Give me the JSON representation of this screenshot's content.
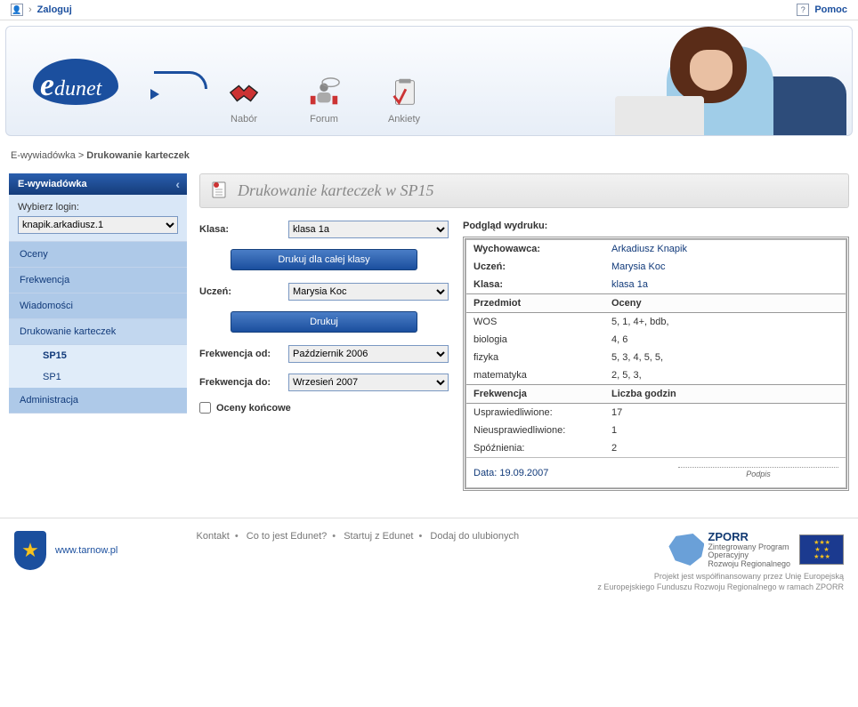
{
  "topbar": {
    "login": "Zaloguj",
    "help": "Pomoc"
  },
  "nav": {
    "items": [
      {
        "label": "Nabór"
      },
      {
        "label": "Forum"
      },
      {
        "label": "Ankiety"
      }
    ]
  },
  "breadcrumb": {
    "a": "E-wywiadówka",
    "b": "Drukowanie karteczek"
  },
  "sidebar": {
    "header": "E-wywiadówka",
    "login_label": "Wybierz login:",
    "login_value": "knapik.arkadiusz.1",
    "items": [
      {
        "label": "Oceny"
      },
      {
        "label": "Frekwencja"
      },
      {
        "label": "Wiadomości"
      },
      {
        "label": "Drukowanie karteczek"
      },
      {
        "label": "Administracja"
      }
    ],
    "sub": [
      {
        "label": "SP15"
      },
      {
        "label": "SP1"
      }
    ]
  },
  "panel": {
    "title": "Drukowanie karteczek w SP15"
  },
  "form": {
    "klasa_label": "Klasa:",
    "klasa_value": "klasa 1a",
    "btn_class": "Drukuj dla całej klasy",
    "uczen_label": "Uczeń:",
    "uczen_value": "Marysia Koc",
    "btn_print": "Drukuj",
    "freq_from_label": "Frekwencja od:",
    "freq_from_value": "Październik 2006",
    "freq_to_label": "Frekwencja do:",
    "freq_to_value": "Wrzesień 2007",
    "final_grades": "Oceny końcowe"
  },
  "preview": {
    "title": "Podgląd wydruku:",
    "wychowawca_k": "Wychowawca:",
    "wychowawca_v": "Arkadiusz Knapik",
    "uczen_k": "Uczeń:",
    "uczen_v": "Marysia Koc",
    "klasa_k": "Klasa:",
    "klasa_v": "klasa 1a",
    "subject_header": "Przedmiot",
    "grades_header": "Oceny",
    "subjects": [
      {
        "name": "WOS",
        "grades": "5, 1, 4+, bdb,"
      },
      {
        "name": "biologia",
        "grades": "4, 6"
      },
      {
        "name": "fizyka",
        "grades": "5, 3, 4, 5, 5,"
      },
      {
        "name": "matematyka",
        "grades": "2, 5, 3,"
      }
    ],
    "freq_header": "Frekwencja",
    "hours_header": "Liczba godzin",
    "freq_rows": [
      {
        "k": "Usprawiedliwione:",
        "v": "17"
      },
      {
        "k": "Nieusprawiedliwione:",
        "v": "1"
      },
      {
        "k": "Spóźnienia:",
        "v": "2"
      }
    ],
    "date": "Data: 19.09.2007",
    "signature": "Podpis"
  },
  "footer": {
    "tarnow": "www.tarnow.pl",
    "links": [
      {
        "label": "Kontakt"
      },
      {
        "label": "Co to jest Edunet?"
      },
      {
        "label": "Startuj z Edunet"
      },
      {
        "label": "Dodaj do ulubionych"
      }
    ],
    "zporr_big": "ZPORR",
    "zporr_small": "Zintegrowany Program\nOperacyjny\nRozwoju Regionalnego",
    "fund1": "Projekt jest współfinansowany przez Unię Europejską",
    "fund2": "z Europejskiego Funduszu Rozwoju Regionalnego w ramach ZPORR"
  }
}
